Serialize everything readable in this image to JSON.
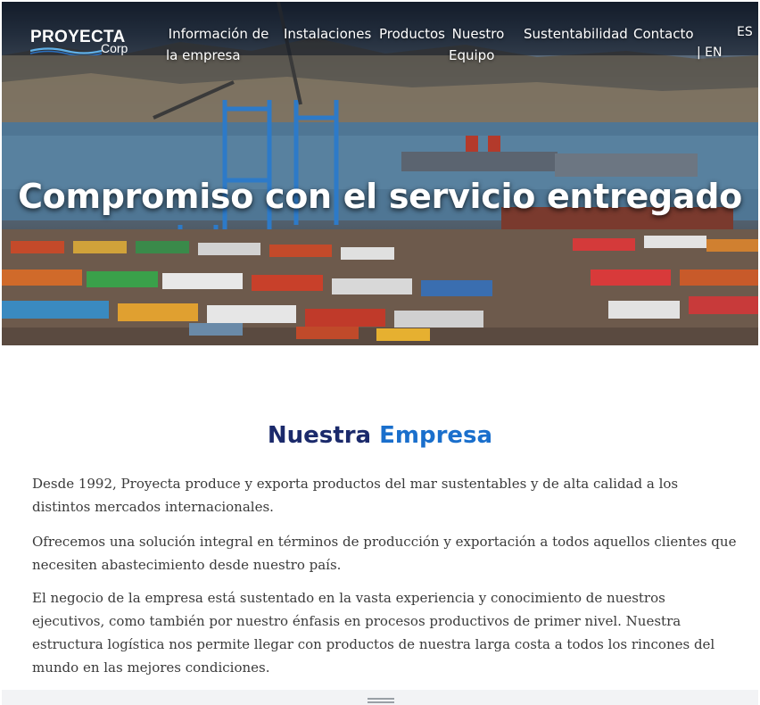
{
  "brand": {
    "name": "PROYECTA",
    "sub": "Corp"
  },
  "nav": {
    "items": [
      {
        "line1": "Información de",
        "line2": "la empresa"
      },
      {
        "line1": "Instalaciones",
        "line2": ""
      },
      {
        "line1": "Productos",
        "line2": ""
      },
      {
        "line1": "Nuestro",
        "line2": "Equipo"
      },
      {
        "line1": "Sustentabilidad",
        "line2": ""
      },
      {
        "line1": "Contacto",
        "line2": ""
      }
    ],
    "lang_es": "ES",
    "lang_en": "| EN"
  },
  "hero": {
    "title": "Compromiso con el servicio entregado"
  },
  "section": {
    "title_part1": "Nuestra",
    "title_part2": "Empresa",
    "paragraphs": [
      "Desde 1992, Proyecta produce y exporta productos del mar sustentables y de alta calidad a los distintos mercados internacionales.",
      "Ofrecemos una solución integral en términos de producción y exportación a todos aquellos clientes que necesiten abastecimiento desde nuestro país.",
      "El negocio de la empresa está sustentado en la vasta experiencia y conocimiento de nuestros ejecutivos, como también por nuestro énfasis en procesos productivos de primer nivel. Nuestra estructura logística nos permite llegar con productos de nuestra larga costa a todos los rincones del mundo en las mejores condiciones."
    ]
  },
  "colors": {
    "title_dark": "#1b2a6b",
    "title_accent": "#1a6fcc",
    "text": "#3a3a3a"
  },
  "icons": {
    "logo_wave": "wave-icon",
    "scroll_handle": "drag-handle-icon"
  }
}
